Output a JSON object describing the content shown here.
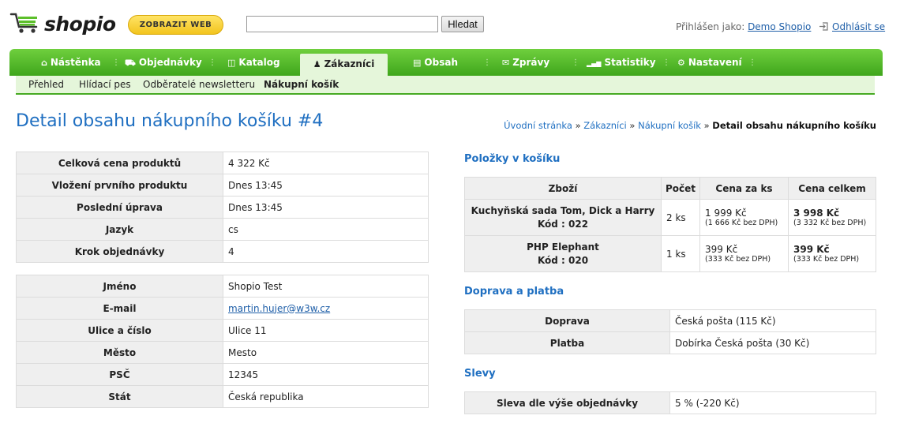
{
  "brand": {
    "name": "shopio",
    "show_web": "ZOBRAZIT WEB"
  },
  "search": {
    "value": "",
    "button": "Hledat"
  },
  "user": {
    "prefix": "Přihlášen jako:",
    "name": "Demo Shopio",
    "logout": "Odhlásit se"
  },
  "nav": [
    {
      "label": "Nástěnka",
      "icon": "home-icon",
      "glyph": "⌂"
    },
    {
      "label": "Objednávky",
      "icon": "cart-icon",
      "glyph": "🛒︎"
    },
    {
      "label": "Katalog",
      "icon": "book-icon",
      "glyph": "◫"
    },
    {
      "label": "Zákazníci",
      "icon": "user-icon",
      "glyph": "●"
    },
    {
      "label": "Obsah",
      "icon": "document-icon",
      "glyph": "▤"
    },
    {
      "label": "Zprávy",
      "icon": "envelope-icon",
      "glyph": "✉"
    },
    {
      "label": "Statistiky",
      "icon": "signal-icon",
      "glyph": "▁▃▅"
    },
    {
      "label": "Nastavení",
      "icon": "gear-icon",
      "glyph": "⚙"
    }
  ],
  "subnav": [
    "Přehled",
    "Hlídací pes",
    "Odběratelé newsletteru",
    "Nákupní košík"
  ],
  "page": {
    "title": "Detail obsahu nákupního košíku #4"
  },
  "breadcrumb": {
    "items": [
      "Úvodní stránka",
      "Zákazníci",
      "Nákupní košík"
    ],
    "current": "Detail obsahu nákupního košíku",
    "separator": "»"
  },
  "cart_info": [
    {
      "label": "Celková cena produktů",
      "value": "4 322 Kč"
    },
    {
      "label": "Vložení prvního produktu",
      "value": "Dnes 13:45"
    },
    {
      "label": "Poslední úprava",
      "value": "Dnes 13:45"
    },
    {
      "label": "Jazyk",
      "value": "cs"
    },
    {
      "label": "Krok objednávky",
      "value": "4"
    }
  ],
  "customer_info": [
    {
      "label": "Jméno",
      "value": "Shopio Test"
    },
    {
      "label": "E-mail",
      "value": "martin.hujer@w3w.cz"
    },
    {
      "label": "Ulice a číslo",
      "value": "Ulice 11"
    },
    {
      "label": "Město",
      "value": "Mesto"
    },
    {
      "label": "PSČ",
      "value": "12345"
    },
    {
      "label": "Stát",
      "value": "Česká republika"
    }
  ],
  "items_section": {
    "title": "Položky v košíku",
    "headers": [
      "Zboží",
      "Počet",
      "Cena za ks",
      "Cena celkem"
    ],
    "rows": [
      {
        "name": "Kuchyňská sada Tom, Dick a Harry",
        "code": "Kód : 022",
        "qty": "2 ks",
        "unit_price": "1 999 Kč",
        "unit_net": "(1 666 Kč bez DPH)",
        "total": "3 998 Kč",
        "total_net": "(3 332 Kč bez DPH)"
      },
      {
        "name": "PHP Elephant",
        "code": "Kód : 020",
        "qty": "1 ks",
        "unit_price": "399 Kč",
        "unit_net": "(333 Kč bez DPH)",
        "total": "399 Kč",
        "total_net": "(333 Kč bez DPH)"
      }
    ]
  },
  "shipping_section": {
    "title": "Doprava a platba",
    "rows": [
      {
        "label": "Doprava",
        "value": "Česká pošta (115 Kč)"
      },
      {
        "label": "Platba",
        "value": "Dobírka Česká pošta (30 Kč)"
      }
    ]
  },
  "discount_section": {
    "title": "Slevy",
    "rows": [
      {
        "label": "Sleva dle výše objednávky",
        "value": "5 % (-220 Kč)"
      }
    ]
  },
  "colors": {
    "green": "#47aa23",
    "link": "#1f6fc1",
    "accent_yellow": "#f2c41d"
  }
}
